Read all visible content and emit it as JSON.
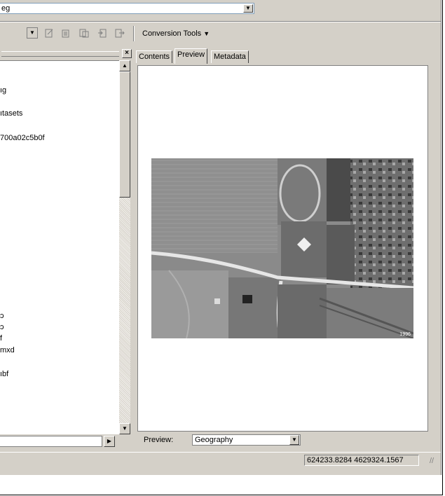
{
  "address": {
    "value": "еg"
  },
  "toolbar": {
    "conversion_tools_label": "Conversion Tools",
    "conversion_arrow": "▼"
  },
  "tree": {
    "items": [
      {
        "label": "ıg"
      },
      {
        "label": "ıtasets"
      },
      {
        "label": "700a02c5b0f"
      },
      {
        "label": "ɔ"
      },
      {
        "label": "ɔ"
      },
      {
        "label": "f"
      },
      {
        "label": "mxd"
      },
      {
        "label": "ıbf"
      }
    ]
  },
  "tabs": [
    {
      "label": "Contents"
    },
    {
      "label": "Preview"
    },
    {
      "label": "Metadata"
    }
  ],
  "preview": {
    "label": "Preview:",
    "selected": "Geography",
    "photo_caption": "1996"
  },
  "status": {
    "coordinates": "624233.8284  4629324.1567"
  },
  "colors": {
    "chrome": "#d4d0c8",
    "border_dark": "#808080",
    "field_border": "#7f9db9"
  }
}
